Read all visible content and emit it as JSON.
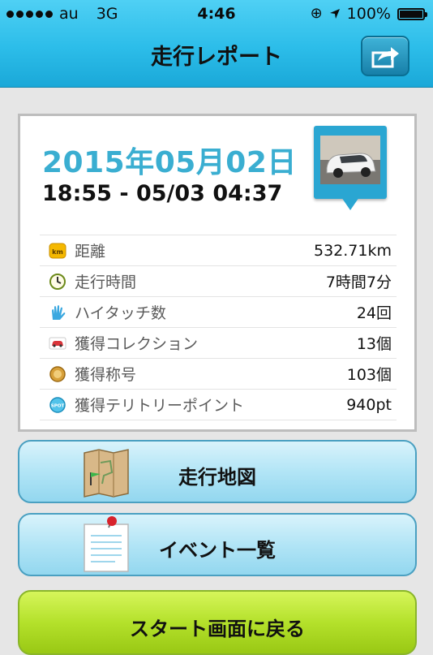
{
  "status_bar": {
    "carrier": "au",
    "network": "3G",
    "time": "4:46",
    "battery": "100%"
  },
  "header": {
    "title": "走行レポート",
    "share_icon": "share-arrow-icon"
  },
  "report": {
    "date": "2015年05月02日",
    "time_range": "18:55 - 05/03 04:37",
    "photo_icon": "car-photo-pin-icon",
    "rows": [
      {
        "icon": "km-icon",
        "label": "距離",
        "value": "532.71km"
      },
      {
        "icon": "clock-icon",
        "label": "走行時間",
        "value": "7時間7分"
      },
      {
        "icon": "high-five-icon",
        "label": "ハイタッチ数",
        "value": "24回"
      },
      {
        "icon": "car-icon",
        "label": "獲得コレクション",
        "value": "13個"
      },
      {
        "icon": "medal-icon",
        "label": "獲得称号",
        "value": "103個"
      },
      {
        "icon": "spot-icon",
        "label": "獲得テリトリーポイント",
        "value": "940pt"
      }
    ]
  },
  "buttons": {
    "map": "走行地図",
    "events": "イベント一覧",
    "start": "スタート画面に戻る"
  },
  "colors": {
    "accent": "#3aaed1",
    "header": "#2cbde9",
    "start_button": "#b4e12b"
  }
}
